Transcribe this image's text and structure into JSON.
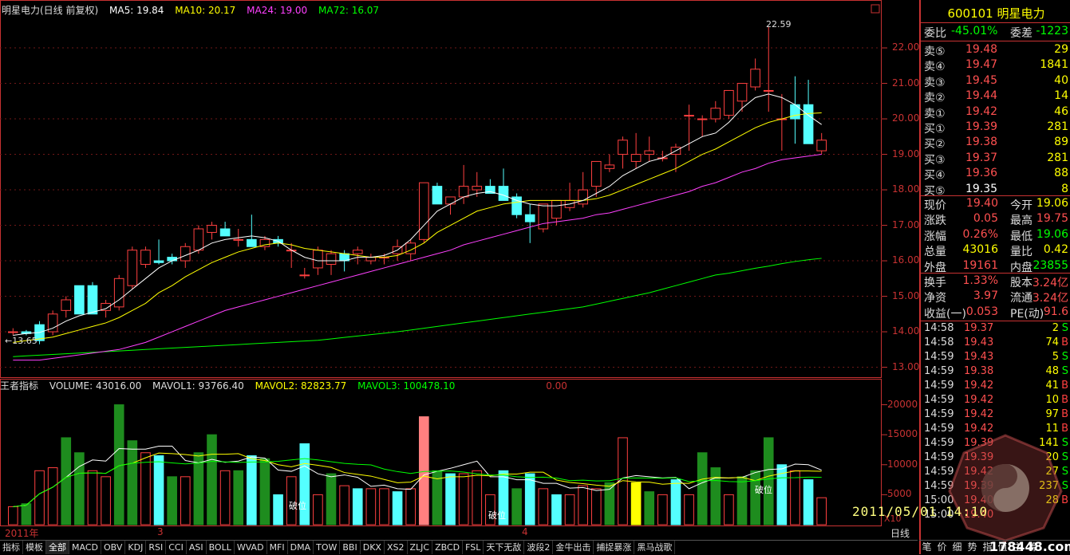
{
  "header": {
    "stock_name": "明星电力(日线 前复权)",
    "ma5": "MA5: 19.84",
    "ma10": "MA10: 20.17",
    "ma24": "MA24: 19.00",
    "ma72": "MA72: 16.07",
    "colors": {
      "ma5": "#ffffff",
      "ma10": "#ffff00",
      "ma24": "#ff40ff",
      "ma72": "#00ff00"
    }
  },
  "volume_header": {
    "title": "王者指标",
    "volume": "VOLUME: 43016.00",
    "mavol1": "MAVOL1: 93766.40",
    "mavol2": "MAVOL2: 82823.77",
    "mavol3": "MAVOL3: 100478.10",
    "extra": "0.00"
  },
  "price_axis": [
    "22.00",
    "21.00",
    "20.00",
    "19.00",
    "18.00",
    "17.00",
    "16.00",
    "15.00",
    "14.00",
    "13.00"
  ],
  "volume_axis": [
    "20000",
    "15000",
    "10000",
    "5000"
  ],
  "volume_unit": "X10",
  "annotations": {
    "high_label": "22.59",
    "low_label": "13.65",
    "break_label": "破位"
  },
  "date_axis": {
    "year": "2011年",
    "m3": "3",
    "m4": "4",
    "period": "日线"
  },
  "chart_data": {
    "type": "candlestick",
    "y_range": [
      12.9,
      22.9
    ],
    "candles": [
      [
        14.0,
        14.1,
        13.9,
        14.0
      ],
      [
        14.0,
        14.05,
        13.9,
        13.95
      ],
      [
        14.2,
        14.3,
        13.65,
        13.75
      ],
      [
        14.0,
        14.6,
        13.9,
        14.5
      ],
      [
        14.6,
        15.0,
        14.4,
        14.9
      ],
      [
        15.3,
        15.3,
        14.5,
        14.5
      ],
      [
        15.3,
        15.4,
        14.5,
        14.5
      ],
      [
        14.6,
        14.9,
        14.4,
        14.8
      ],
      [
        14.7,
        15.6,
        14.6,
        15.5
      ],
      [
        15.3,
        16.4,
        15.2,
        16.3
      ],
      [
        15.9,
        16.4,
        15.8,
        16.3
      ],
      [
        16.0,
        16.6,
        15.9,
        15.95
      ],
      [
        16.1,
        16.2,
        15.9,
        16.0
      ],
      [
        16.0,
        16.5,
        15.8,
        16.4
      ],
      [
        16.3,
        17.0,
        16.2,
        16.9
      ],
      [
        16.8,
        17.1,
        16.6,
        17.0
      ],
      [
        16.9,
        17.1,
        16.7,
        16.7
      ],
      [
        16.6,
        16.9,
        16.4,
        16.6
      ],
      [
        16.6,
        17.3,
        16.4,
        16.4
      ],
      [
        16.4,
        16.7,
        16.3,
        16.6
      ],
      [
        16.6,
        16.7,
        16.4,
        16.5
      ],
      [
        16.3,
        16.5,
        15.8,
        16.3
      ],
      [
        15.6,
        15.8,
        15.5,
        15.6
      ],
      [
        15.8,
        16.4,
        15.6,
        16.3
      ],
      [
        15.9,
        16.3,
        15.6,
        16.2
      ],
      [
        16.2,
        16.3,
        15.7,
        16.0
      ],
      [
        16.2,
        16.4,
        15.9,
        16.3
      ],
      [
        16.0,
        16.2,
        15.9,
        16.1
      ],
      [
        16.1,
        16.2,
        15.9,
        16.1
      ],
      [
        16.2,
        16.6,
        16.0,
        16.4
      ],
      [
        16.2,
        16.6,
        16.0,
        16.5
      ],
      [
        16.6,
        18.2,
        16.5,
        18.2
      ],
      [
        18.1,
        18.2,
        17.6,
        17.6
      ],
      [
        17.6,
        17.8,
        17.3,
        17.8
      ],
      [
        17.8,
        18.7,
        17.6,
        18.1
      ],
      [
        18.0,
        18.5,
        17.8,
        18.1
      ],
      [
        18.1,
        18.3,
        17.9,
        17.9
      ],
      [
        18.1,
        18.6,
        17.7,
        17.7
      ],
      [
        17.8,
        17.9,
        17.2,
        17.3
      ],
      [
        17.3,
        17.6,
        16.5,
        17.1
      ],
      [
        16.9,
        17.4,
        16.8,
        17.6
      ],
      [
        17.2,
        17.7,
        17.0,
        17.7
      ],
      [
        17.5,
        18.2,
        17.4,
        17.7
      ],
      [
        17.6,
        18.5,
        17.5,
        18.0
      ],
      [
        18.1,
        18.4,
        17.8,
        18.8
      ],
      [
        18.6,
        19.0,
        18.5,
        18.7
      ],
      [
        19.0,
        19.5,
        18.6,
        19.4
      ],
      [
        18.8,
        19.6,
        18.6,
        19.0
      ],
      [
        19.0,
        19.5,
        18.8,
        19.1
      ],
      [
        18.9,
        19.1,
        18.8,
        18.9
      ],
      [
        19.0,
        19.3,
        18.5,
        19.2
      ],
      [
        20.1,
        20.4,
        19.1,
        20.1
      ],
      [
        20.0,
        20.1,
        19.5,
        20.0
      ],
      [
        20.0,
        20.5,
        19.9,
        20.3
      ],
      [
        20.1,
        20.6,
        20.0,
        20.8
      ],
      [
        20.5,
        21.0,
        20.2,
        21.0
      ],
      [
        20.9,
        21.7,
        20.8,
        21.4
      ],
      [
        20.8,
        22.59,
        20.2,
        20.8
      ],
      [
        20.0,
        20.7,
        19.1,
        20.0
      ],
      [
        20.4,
        21.2,
        19.3,
        20.0
      ],
      [
        20.4,
        21.1,
        19.3,
        19.3
      ],
      [
        19.1,
        19.6,
        19.0,
        19.4
      ]
    ],
    "ma5": [
      13.9,
      13.95,
      13.98,
      14.1,
      14.3,
      14.45,
      14.55,
      14.65,
      14.9,
      15.2,
      15.5,
      15.8,
      16.0,
      16.15,
      16.3,
      16.5,
      16.6,
      16.65,
      16.7,
      16.65,
      16.55,
      16.3,
      16.1,
      16.0,
      16.0,
      16.0,
      16.1,
      16.1,
      16.15,
      16.3,
      16.6,
      17.0,
      17.4,
      17.6,
      17.8,
      17.9,
      17.95,
      17.85,
      17.7,
      17.6,
      17.55,
      17.55,
      17.6,
      17.7,
      17.9,
      18.1,
      18.4,
      18.6,
      18.8,
      18.9,
      19.1,
      19.3,
      19.5,
      19.6,
      19.9,
      20.3,
      20.6,
      20.7,
      20.6,
      20.4,
      20.1,
      19.84
    ],
    "ma10": [
      13.7,
      13.75,
      13.8,
      13.85,
      13.95,
      14.05,
      14.15,
      14.25,
      14.4,
      14.6,
      14.8,
      15.1,
      15.3,
      15.55,
      15.75,
      15.95,
      16.1,
      16.25,
      16.35,
      16.45,
      16.5,
      16.45,
      16.35,
      16.3,
      16.25,
      16.2,
      16.15,
      16.1,
      16.1,
      16.15,
      16.3,
      16.5,
      16.8,
      17.0,
      17.2,
      17.4,
      17.5,
      17.6,
      17.65,
      17.7,
      17.7,
      17.7,
      17.7,
      17.7,
      17.75,
      17.85,
      18.0,
      18.15,
      18.3,
      18.45,
      18.6,
      18.8,
      19.0,
      19.15,
      19.35,
      19.55,
      19.75,
      19.9,
      20.0,
      20.1,
      20.15,
      20.17
    ],
    "ma24": [
      13.2,
      13.2,
      13.2,
      13.25,
      13.3,
      13.35,
      13.4,
      13.45,
      13.5,
      13.6,
      13.7,
      13.85,
      14.0,
      14.15,
      14.3,
      14.45,
      14.6,
      14.7,
      14.8,
      14.9,
      15.0,
      15.1,
      15.2,
      15.3,
      15.4,
      15.5,
      15.6,
      15.7,
      15.8,
      15.9,
      16.0,
      16.1,
      16.2,
      16.3,
      16.45,
      16.55,
      16.65,
      16.75,
      16.85,
      16.95,
      17.05,
      17.1,
      17.15,
      17.2,
      17.3,
      17.35,
      17.45,
      17.55,
      17.65,
      17.75,
      17.85,
      17.95,
      18.1,
      18.2,
      18.35,
      18.5,
      18.6,
      18.75,
      18.85,
      18.9,
      18.95,
      19.0
    ],
    "ma72": [
      13.3,
      13.32,
      13.34,
      13.36,
      13.38,
      13.4,
      13.42,
      13.44,
      13.46,
      13.48,
      13.5,
      13.52,
      13.54,
      13.56,
      13.58,
      13.6,
      13.62,
      13.64,
      13.66,
      13.68,
      13.7,
      13.72,
      13.74,
      13.76,
      13.8,
      13.84,
      13.88,
      13.92,
      13.96,
      14.0,
      14.05,
      14.1,
      14.15,
      14.2,
      14.25,
      14.3,
      14.35,
      14.4,
      14.45,
      14.5,
      14.55,
      14.6,
      14.65,
      14.7,
      14.78,
      14.86,
      14.94,
      15.02,
      15.1,
      15.2,
      15.3,
      15.4,
      15.5,
      15.6,
      15.65,
      15.72,
      15.79,
      15.85,
      15.92,
      15.98,
      16.03,
      16.07
    ],
    "volume_range": [
      0,
      23000
    ],
    "volumes": [
      [
        3000,
        "r"
      ],
      [
        3500,
        "g"
      ],
      [
        9000,
        "r"
      ],
      [
        9500,
        "r"
      ],
      [
        14500,
        "g"
      ],
      [
        12000,
        "g"
      ],
      [
        9000,
        "r"
      ],
      [
        8000,
        "r"
      ],
      [
        20000,
        "g"
      ],
      [
        14000,
        "g"
      ],
      [
        12000,
        "r"
      ],
      [
        11500,
        "c"
      ],
      [
        8000,
        "g"
      ],
      [
        8000,
        "r"
      ],
      [
        12000,
        "g"
      ],
      [
        15000,
        "g"
      ],
      [
        9000,
        "r"
      ],
      [
        9000,
        "g"
      ],
      [
        11500,
        "c"
      ],
      [
        11000,
        "g"
      ],
      [
        5000,
        "c"
      ],
      [
        8000,
        "r"
      ],
      [
        13500,
        "c"
      ],
      [
        5000,
        "r"
      ],
      [
        8500,
        "g"
      ],
      [
        6500,
        "r"
      ],
      [
        6000,
        "c"
      ],
      [
        6000,
        "r"
      ],
      [
        6000,
        "r"
      ],
      [
        5500,
        "c"
      ],
      [
        6000,
        "r"
      ],
      [
        18000,
        "p"
      ],
      [
        9000,
        "g"
      ],
      [
        8500,
        "c"
      ],
      [
        8500,
        "r"
      ],
      [
        9000,
        "r"
      ],
      [
        5000,
        "r"
      ],
      [
        9000,
        "c"
      ],
      [
        6000,
        "g"
      ],
      [
        8500,
        "c"
      ],
      [
        6000,
        "r"
      ],
      [
        5000,
        "c"
      ],
      [
        5000,
        "r"
      ],
      [
        6500,
        "r"
      ],
      [
        6000,
        "r"
      ],
      [
        7000,
        "g"
      ],
      [
        14500,
        "r"
      ],
      [
        7000,
        "y"
      ],
      [
        5500,
        "g"
      ],
      [
        5000,
        "r"
      ],
      [
        7500,
        "c"
      ],
      [
        5000,
        "r"
      ],
      [
        12000,
        "g"
      ],
      [
        9500,
        "g"
      ],
      [
        5000,
        "r"
      ],
      [
        8000,
        "g"
      ],
      [
        9000,
        "g"
      ],
      [
        14500,
        "g"
      ],
      [
        10000,
        "c"
      ],
      [
        9000,
        "r"
      ],
      [
        7500,
        "c"
      ],
      [
        4500,
        "r"
      ]
    ]
  },
  "quote": {
    "code": "600101",
    "name": "明星电力",
    "wei_bi_label": "委比",
    "wei_bi": "-45.01%",
    "wei_cha_label": "委差",
    "wei_cha": "-1223",
    "sell": [
      {
        "label": "卖⑤",
        "price": "19.48",
        "vol": "29"
      },
      {
        "label": "卖④",
        "price": "19.47",
        "vol": "1841"
      },
      {
        "label": "卖③",
        "price": "19.45",
        "vol": "40"
      },
      {
        "label": "卖②",
        "price": "19.44",
        "vol": "14"
      },
      {
        "label": "卖①",
        "price": "19.42",
        "vol": "46"
      }
    ],
    "buy": [
      {
        "label": "买①",
        "price": "19.39",
        "vol": "281"
      },
      {
        "label": "买②",
        "price": "19.38",
        "vol": "89"
      },
      {
        "label": "买③",
        "price": "19.37",
        "vol": "281"
      },
      {
        "label": "买④",
        "price": "19.36",
        "vol": "88"
      },
      {
        "label": "买⑤",
        "price": "19.35",
        "vol": "8"
      }
    ],
    "stats": [
      [
        "现价",
        "19.40",
        "今开",
        "19.06"
      ],
      [
        "涨跌",
        "0.05",
        "最高",
        "19.75"
      ],
      [
        "涨幅",
        "0.26%",
        "最低",
        "19.06"
      ],
      [
        "总量",
        "43016",
        "量比",
        "0.42"
      ],
      [
        "外盘",
        "19161",
        "内盘",
        "23855"
      ]
    ],
    "stats2": [
      [
        "换手",
        "1.33%",
        "股本",
        "3.24亿"
      ],
      [
        "净资",
        "3.97",
        "流通",
        "3.24亿"
      ],
      [
        "收益(一)",
        "0.053",
        "PE(动)",
        "91.6"
      ]
    ],
    "ticks": [
      [
        "14:58",
        "19.37",
        "2",
        "S"
      ],
      [
        "14:58",
        "19.43",
        "74",
        "B"
      ],
      [
        "14:59",
        "19.43",
        "5",
        "S"
      ],
      [
        "14:59",
        "19.38",
        "48",
        "S"
      ],
      [
        "14:59",
        "19.42",
        "41",
        "B"
      ],
      [
        "14:59",
        "19.42",
        "10",
        "B"
      ],
      [
        "14:59",
        "19.42",
        "97",
        "B"
      ],
      [
        "14:59",
        "19.42",
        "11",
        "B"
      ],
      [
        "14:59",
        "19.39",
        "141",
        "S"
      ],
      [
        "14:59",
        "19.39",
        "20",
        "S"
      ],
      [
        "14:59",
        "19.42",
        "27",
        "S"
      ],
      [
        "14:59",
        "19.39",
        "237",
        "S"
      ],
      [
        "15:00",
        "19.40",
        "28",
        "B"
      ],
      [
        "15:00",
        "19.40",
        "",
        ""
      ]
    ]
  },
  "tabs": [
    "指标",
    "模板",
    "全部",
    "MACD",
    "OBV",
    "KDJ",
    "RSI",
    "CCI",
    "ASI",
    "BOLL",
    "WVAD",
    "MFI",
    "DMA",
    "TOW",
    "BBI",
    "DKX",
    "XS2",
    "ZLJC",
    "ZBCD",
    "FSL",
    "天下无敌",
    "波段2",
    "金牛出击",
    "捕捉暴涨",
    "黑马战歌"
  ],
  "active_tab": "全部",
  "right_tabs": [
    "笔",
    "价",
    "细",
    "势",
    "指",
    "值",
    "主",
    "筹"
  ],
  "watermark": {
    "date": "2011/05/01  14:10",
    "site": "178448.com"
  }
}
